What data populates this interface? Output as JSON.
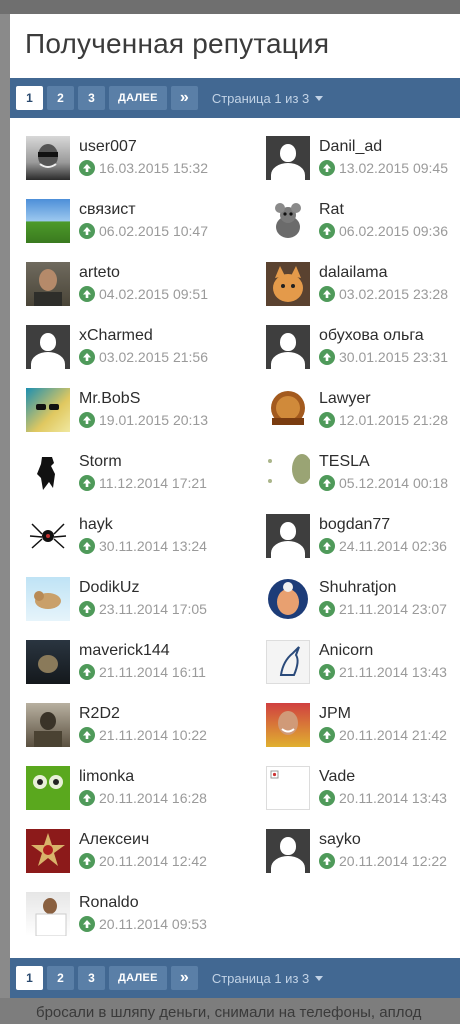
{
  "modal": {
    "title": "Полученная репутация"
  },
  "pagination": {
    "pages": [
      "1",
      "2",
      "3"
    ],
    "active_page": "1",
    "next_label": "ДАЛЕЕ",
    "last_label": "»",
    "info": "Страница 1 из 3"
  },
  "background": {
    "bottom_text": "бросали в шляпу деньги, снимали на телефоны, аплод"
  },
  "colors": {
    "header_bar": "#426892",
    "reputation_up": "#4f9a5a"
  },
  "entries": [
    {
      "name": "user007",
      "date": "16.03.2015 15:32",
      "avatar": "photo-man-glasses"
    },
    {
      "name": "Danil_ad",
      "date": "13.02.2015 09:45",
      "avatar": "default-silhouette"
    },
    {
      "name": "связист",
      "date": "06.02.2015 10:47",
      "avatar": "landscape-field"
    },
    {
      "name": "Rat",
      "date": "06.02.2015 09:36",
      "avatar": "rat-cartoon"
    },
    {
      "name": "arteto",
      "date": "04.02.2015 09:51",
      "avatar": "photo-man"
    },
    {
      "name": "dalailama",
      "date": "03.02.2015 23:28",
      "avatar": "cat-orange"
    },
    {
      "name": "xCharmed",
      "date": "03.02.2015 21:56",
      "avatar": "default-silhouette"
    },
    {
      "name": "обухова ольга",
      "date": "30.01.2015 23:31",
      "avatar": "default-silhouette"
    },
    {
      "name": "Mr.BobS",
      "date": "19.01.2015 20:13",
      "avatar": "sunglasses-art"
    },
    {
      "name": "Lawyer",
      "date": "12.01.2015 21:28",
      "avatar": "notarius-badge"
    },
    {
      "name": "Storm",
      "date": "11.12.2014 17:21",
      "avatar": "black-silhouette"
    },
    {
      "name": "TESLA",
      "date": "05.12.2014 00:18",
      "avatar": "abstract-green"
    },
    {
      "name": "hayk",
      "date": "30.11.2014 13:24",
      "avatar": "spider"
    },
    {
      "name": "bogdan77",
      "date": "24.11.2014 02:36",
      "avatar": "default-silhouette"
    },
    {
      "name": "DodikUz",
      "date": "23.11.2014 17:05",
      "avatar": "flying-dog"
    },
    {
      "name": "Shuhratjon",
      "date": "21.11.2014 23:07",
      "avatar": "cartoon-doctor"
    },
    {
      "name": "maverick144",
      "date": "21.11.2014 16:11",
      "avatar": "dark-photo"
    },
    {
      "name": "Anicorn",
      "date": "21.11.2014 13:43",
      "avatar": "unicorn-logo"
    },
    {
      "name": "R2D2",
      "date": "21.11.2014 10:22",
      "avatar": "soldier"
    },
    {
      "name": "JPM",
      "date": "20.11.2014 21:42",
      "avatar": "photo-man-smile"
    },
    {
      "name": "limonka",
      "date": "20.11.2014 16:28",
      "avatar": "green-character"
    },
    {
      "name": "Vade",
      "date": "20.11.2014 13:43",
      "avatar": "broken-image"
    },
    {
      "name": "Алексеич",
      "date": "20.11.2014 12:42",
      "avatar": "order-medal"
    },
    {
      "name": "sayko",
      "date": "20.11.2014 12:22",
      "avatar": "default-silhouette"
    },
    {
      "name": "Ronaldo",
      "date": "20.11.2014 09:53",
      "avatar": "footballer"
    }
  ]
}
